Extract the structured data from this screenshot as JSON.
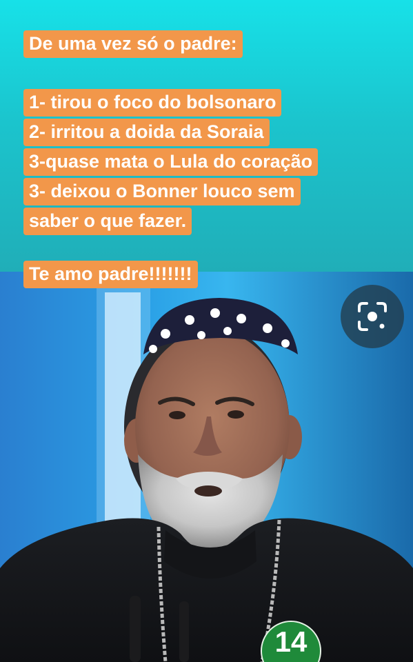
{
  "caption": {
    "heading": "De uma vez só o padre:",
    "list": [
      "1- tirou o foco do bolsonaro",
      "2- irritou a doida da Soraia",
      "3-quase mata o Lula do coração",
      "3- deixou o Bonner louco sem",
      "saber o que fazer."
    ],
    "closing": "Te amo padre!!!!!!!"
  },
  "badge": {
    "number": "14"
  },
  "lens_button": {
    "icon": "google-lens-icon"
  },
  "colors": {
    "caption_bg": "#f2974a",
    "caption_text": "#ffffff",
    "top_panel": "#1bc4cd",
    "badge_green": "#1f8a3a"
  }
}
